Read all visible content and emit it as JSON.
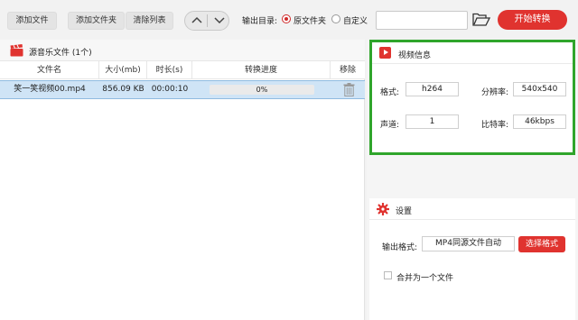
{
  "toolbar": {
    "add_file": "添加文件",
    "add_folder": "添加文件夹",
    "clear_list": "清除列表",
    "output_dir_label": "输出目录:",
    "option_source": "原文件夹",
    "option_custom": "自定义",
    "output_path": "",
    "start_button": "开始转换"
  },
  "file_list": {
    "title": "源音乐文件 (1个)",
    "columns": [
      "文件名",
      "大小(mb)",
      "时长(s)",
      "转换进度",
      "移除"
    ],
    "rows": [
      {
        "name": "笑一笑视频00.mp4",
        "size": "856.09 KB",
        "duration": "00:00:10",
        "progress": "0%",
        "progress_value": 0
      }
    ]
  },
  "video_info": {
    "title": "视频信息",
    "format_label": "格式:",
    "format_value": "h264",
    "resolution_label": "分辨率:",
    "resolution_value": "540x540",
    "channels_label": "声道:",
    "channels_value": "1",
    "bitrate_label": "比特率:",
    "bitrate_value": "46kbps"
  },
  "settings": {
    "title": "设置",
    "output_format_label": "输出格式:",
    "output_format_value": "MP4同源文件自动",
    "choose_format_button": "选择格式",
    "merge_label": "合并为一个文件",
    "merge_checked": false
  },
  "colors": {
    "accent": "#e0332f",
    "highlight_border": "#2fa52b",
    "selected_row": "#cfe4f6"
  }
}
